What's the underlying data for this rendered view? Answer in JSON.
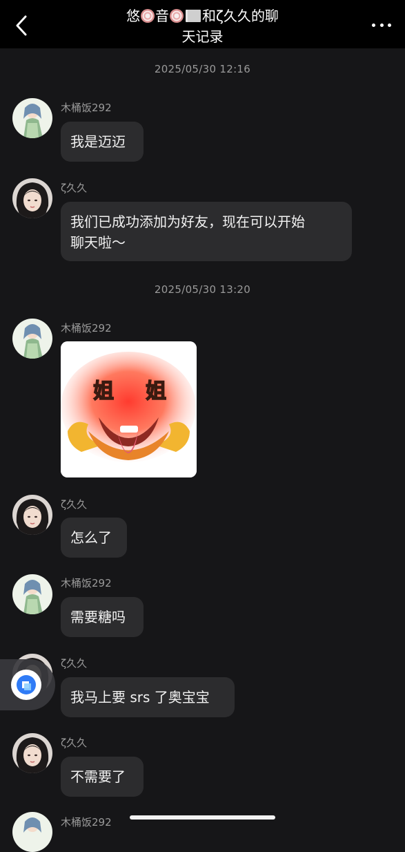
{
  "header": {
    "title_p1": "悠",
    "title_p2": "音",
    "title_p3": "和ζ久久",
    "title_p4": "的聊",
    "title_line2": "天记录"
  },
  "messages": [
    {
      "timestamp": "2025/05/30 12:16"
    },
    {
      "sender": "木桶饭292",
      "text": "我是迈迈"
    },
    {
      "sender": "ζ久久",
      "text1": "我们已成功添加为好友，现在可以开始",
      "text2": "聊天啦～"
    },
    {
      "timestamp": "2025/05/30 13:20"
    },
    {
      "sender": "木桶饭292",
      "sticker_text": "姐 姐",
      "sticker_char1": "姐",
      "sticker_char2": "姐"
    },
    {
      "sender": "ζ久久",
      "text": "怎么了"
    },
    {
      "sender": "木桶饭292",
      "text": "需要糖吗"
    },
    {
      "sender": "ζ久久",
      "text": "我马上要 srs 了奥宝宝"
    },
    {
      "sender": "ζ久久",
      "text": "不需要了"
    },
    {
      "sender": "木桶饭292"
    }
  ],
  "colors": {
    "background": "#161618",
    "bubble": "#2c2c2e",
    "header": "#000000",
    "name_text": "#9a9a9a"
  },
  "icons": [
    "back-chevron-icon",
    "more-dots-icon",
    "floating-assistant-icon"
  ]
}
